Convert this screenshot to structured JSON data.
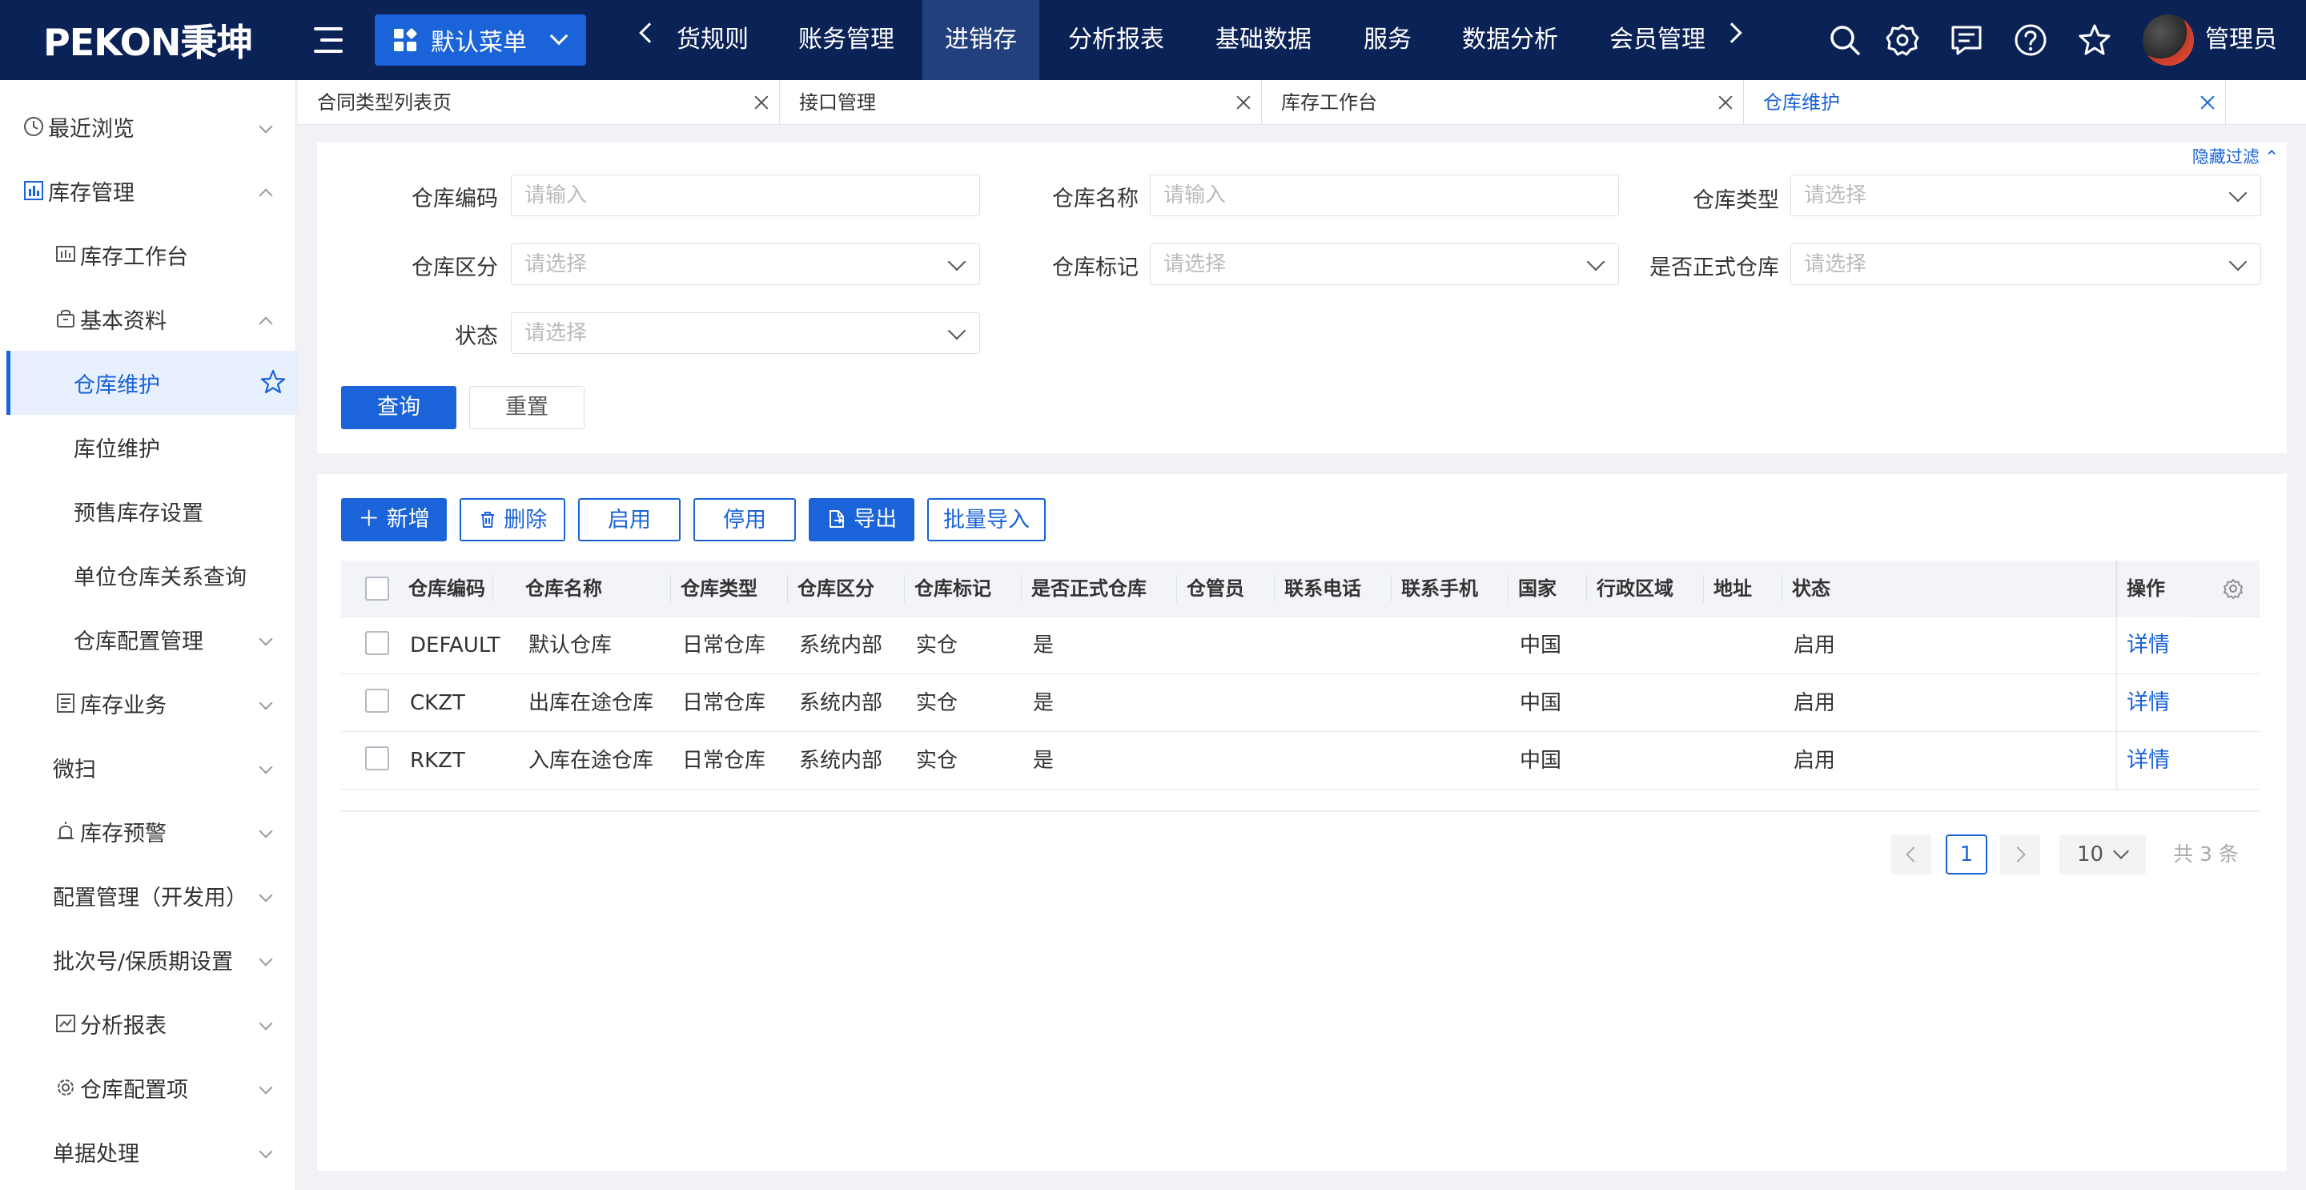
{
  "topbar": {
    "logo": "PEKON秉坤",
    "menu_select": "默认菜单",
    "nav_items": [
      "货规则",
      "账务管理",
      "进销存",
      "分析报表",
      "基础数据",
      "服务",
      "数据分析",
      "会员管理"
    ],
    "active_nav": "进销存",
    "username": "管理员"
  },
  "sidebar": {
    "items": [
      {
        "label": "最近浏览",
        "icon": "clock-icon"
      },
      {
        "label": "库存管理",
        "icon": "chart-icon"
      },
      {
        "label": "库存工作台",
        "icon": "dashboard-icon"
      },
      {
        "label": "基本资料",
        "icon": "bag-icon"
      },
      {
        "label": "仓库维护"
      },
      {
        "label": "库位维护"
      },
      {
        "label": "预售库存设置"
      },
      {
        "label": "单位仓库关系查询"
      },
      {
        "label": "仓库配置管理"
      },
      {
        "label": "库存业务",
        "icon": "document-icon"
      },
      {
        "label": "微扫"
      },
      {
        "label": "库存预警",
        "icon": "alarm-icon"
      },
      {
        "label": "配置管理（开发用）"
      },
      {
        "label": "批次号/保质期设置"
      },
      {
        "label": "分析报表",
        "icon": "chart-line-icon"
      },
      {
        "label": "仓库配置项",
        "icon": "gear-icon"
      },
      {
        "label": "单据处理"
      }
    ]
  },
  "tabs": [
    {
      "label": "合同类型列表页"
    },
    {
      "label": "接口管理"
    },
    {
      "label": "库存工作台"
    },
    {
      "label": "仓库维护"
    }
  ],
  "filter": {
    "hide_label": "隐藏过滤",
    "fields": {
      "code": {
        "label": "仓库编码",
        "placeholder": "请输入"
      },
      "name": {
        "label": "仓库名称",
        "placeholder": "请输入"
      },
      "type": {
        "label": "仓库类型",
        "placeholder": "请选择"
      },
      "zone": {
        "label": "仓库区分",
        "placeholder": "请选择"
      },
      "mark": {
        "label": "仓库标记",
        "placeholder": "请选择"
      },
      "formal": {
        "label": "是否正式仓库",
        "placeholder": "请选择"
      },
      "status": {
        "label": "状态",
        "placeholder": "请选择"
      }
    },
    "query_label": "查询",
    "reset_label": "重置"
  },
  "toolbar": {
    "add": "新增",
    "delete": "删除",
    "enable": "启用",
    "disable": "停用",
    "export": "导出",
    "import": "批量导入"
  },
  "table": {
    "columns": [
      "仓库编码",
      "仓库名称",
      "仓库类型",
      "仓库区分",
      "仓库标记",
      "是否正式仓库",
      "仓管员",
      "联系电话",
      "联系手机",
      "国家",
      "行政区域",
      "地址",
      "状态",
      "操作"
    ],
    "rows": [
      {
        "code": "DEFAULT",
        "name": "默认仓库",
        "type": "日常仓库",
        "zone": "系统内部",
        "mark": "实仓",
        "formal": "是",
        "country": "中国",
        "status": "启用",
        "action": "详情"
      },
      {
        "code": "CKZT",
        "name": "出库在途仓库",
        "type": "日常仓库",
        "zone": "系统内部",
        "mark": "实仓",
        "formal": "是",
        "country": "中国",
        "status": "启用",
        "action": "详情"
      },
      {
        "code": "RKZT",
        "name": "入库在途仓库",
        "type": "日常仓库",
        "zone": "系统内部",
        "mark": "实仓",
        "formal": "是",
        "country": "中国",
        "status": "启用",
        "action": "详情"
      }
    ]
  },
  "pagination": {
    "current": "1",
    "page_size": "10",
    "total": "共 3 条"
  },
  "colors": {
    "topbar": "#0b2256",
    "accent": "#1a63d8"
  }
}
